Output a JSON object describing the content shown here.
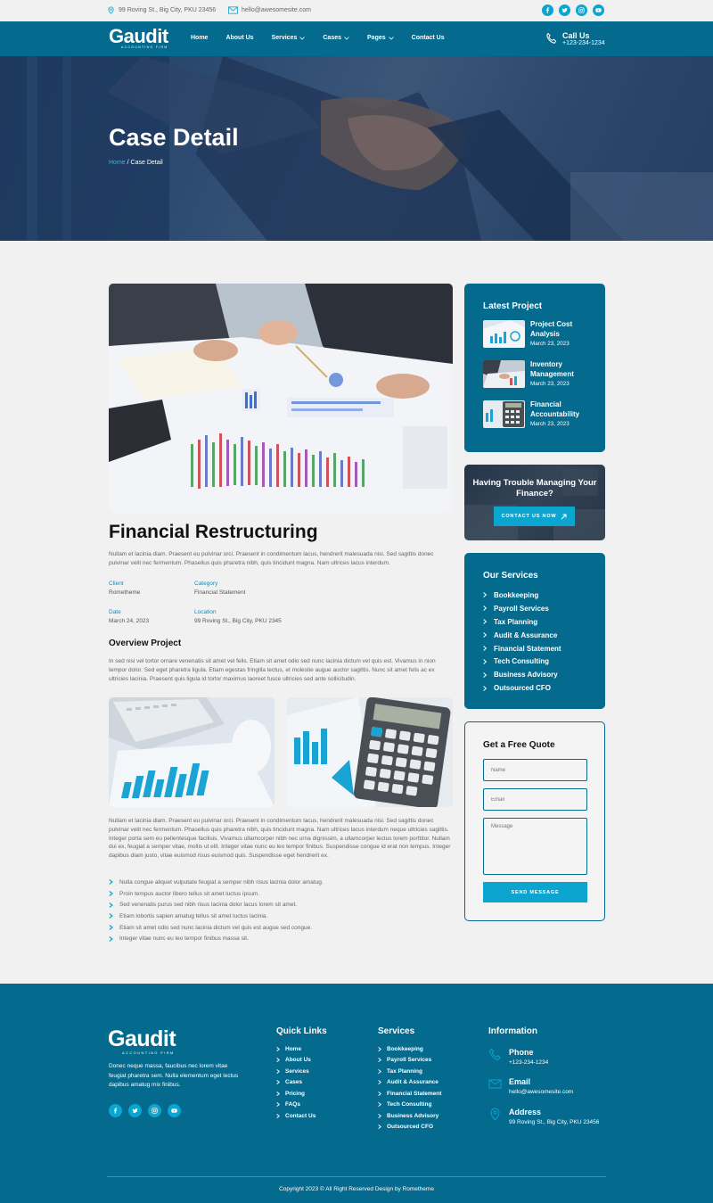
{
  "topbar": {
    "address": "99 Roving St., Big City, PKU 23456",
    "email": "hello@awesomesite.com",
    "social_icons": [
      "facebook-icon",
      "twitter-icon",
      "instagram-icon",
      "youtube-icon"
    ]
  },
  "nav": {
    "logo_word": "Gaudit",
    "logo_sub": "ACCOUNTING FIRM",
    "menu": [
      {
        "label": "Home",
        "dropdown": false
      },
      {
        "label": "About Us",
        "dropdown": false
      },
      {
        "label": "Services",
        "dropdown": true
      },
      {
        "label": "Cases",
        "dropdown": true
      },
      {
        "label": "Pages",
        "dropdown": true
      },
      {
        "label": "Contact Us",
        "dropdown": false
      }
    ],
    "call_label": "Call Us",
    "call_number": "+123-234-1234"
  },
  "hero": {
    "title": "Case Detail",
    "breadcrumb_home": "Home",
    "breadcrumb_sep": " / ",
    "breadcrumb_current": "Case Detail"
  },
  "case": {
    "title": "Financial Restructuring",
    "intro": "Nullam et lacinia diam. Praesent eu pulvinar orci. Praesent in condimentum lacus, hendrerit malesuada nisi. Sed sagittis donec pulvinar velit nec fermentum. Phasellus quis pharetra nibh, quis tincidunt magna. Nam ultrices lacus interdum.",
    "meta": [
      {
        "key": "Client",
        "value": "Rometheme"
      },
      {
        "key": "Category",
        "value": "Financial Statement"
      },
      {
        "key": "Date",
        "value": "March 24, 2023"
      },
      {
        "key": "Location",
        "value": "99 Roving St., Big City, PKU 2345"
      }
    ],
    "overview_title": "Overview Project",
    "overview_text": "In sed nisi vel tortor ornare venenatis sit amet vel felis. Etiam sit amet odio sed nunc lacinia dictum vel quis est. Vivamus in nion tempor dolor. Sed eget pharetra ligula. Etiam egestas fringilla lectus, et molestie augue auctor sagittis. Nunc sit amet felis ac ex ultricies lacinia. Praesent quis ligula id tortor maximus laoreet fusce ultricies sed ante sollicitudin.",
    "body_text": "Nullam et lacinia diam. Praesent eu pulvinar orci. Praesent in condimentum lacus, hendrerit malesuada nisi. Sed sagittis donec pulvinar velit nec fermentum. Phasellus quis pharetra nibh, quis tincidunt magna. Nam ultrices lacus interdum neque ultricies sagittis. Integer porta sem eu pellentesque facilisis. Vivamus ullamcorper nibh nec urna dignissim, a ullamcorper lectus  lorem porttitor. Nullam dui ex, feugiat a semper vitae, mollis ut elit. Integer vitae nunc eu leo tempor finibus. Suspendisse congue id erat non tempus. Integer dapibus diam justo, vitae euismod risus euismod quis. Suspendisse eget hendrerit ex.",
    "bullets": [
      "Nulla congue aliquet vulputate feugiat a semper nibh risus lacinia dolor amatug.",
      "Proin tempus auctor libero tellus sit amet luctus ipsum.",
      "Sed venenatis purus sed nibh risus lacinia dolor lacus lorem sit amet.",
      "Etiam lobortis sapien amatug tellus sit amet luctus lacinia.",
      "Etiam sit amet odio sed nunc lacinia dictum vel quis est augue sed congue.",
      "Integer vitae nunc eu leo tempor finibus massa sit."
    ]
  },
  "sidebar": {
    "latest_title": "Latest Project",
    "latest": [
      {
        "name": "Project Cost Analysis",
        "date": "March 23, 2023"
      },
      {
        "name": "Inventory Management",
        "date": "March 23, 2023"
      },
      {
        "name": "Financial Accountability",
        "date": "March 23, 2023"
      }
    ],
    "trouble_text": "Having Trouble Managing Your Finance?",
    "contact_button": "CONTACT US NOW",
    "services_title": "Our Services",
    "services": [
      "Bookkeeping",
      "Payroll Services",
      "Tax Planning",
      "Audit & Assurance",
      "Financial Statement",
      "Tech Consulting",
      "Business Advisory",
      "Outsourced CFO"
    ],
    "quote_title": "Get a Free Quote",
    "name_placeholder": "Name",
    "email_placeholder": "Email",
    "message_placeholder": "Message",
    "send_button": "SEND MESSAGE"
  },
  "footer": {
    "logo_word": "Gaudit",
    "logo_sub": "ACCOUNTING FIRM",
    "description": "Donec neque massa, faucibus nec lorem vitae feugiat pharetra sem. Nulla elementum eget lectus dapibus amatug mix finibus.",
    "quick_links_title": "Quick Links",
    "quick_links": [
      "Home",
      "About Us",
      "Services",
      "Cases",
      "Pricing",
      "FAQs",
      "Contact Us"
    ],
    "services_title": "Services",
    "services": [
      "Bookkeeping",
      "Payroll Services",
      "Tax Planning",
      "Audit & Assurance",
      "Financial Statement",
      "Tech Consulting",
      "Business Advisory",
      "Outsourced CFO"
    ],
    "info_title": "Information",
    "info": [
      {
        "key": "Phone",
        "value": "+123-234-1234",
        "icon": "phone-icon"
      },
      {
        "key": "Email",
        "value": "hello@awesomesite.com",
        "icon": "mail-icon"
      },
      {
        "key": "Address",
        "value": "99 Roving St., Big City, PKU 23456",
        "icon": "location-icon"
      }
    ],
    "copyright": "Copyright 2023 © All Right Reserved Design by Rometheme"
  },
  "colors": {
    "primary": "#046a8e",
    "accent": "#0ba5cf",
    "background": "#f1f1f1"
  }
}
